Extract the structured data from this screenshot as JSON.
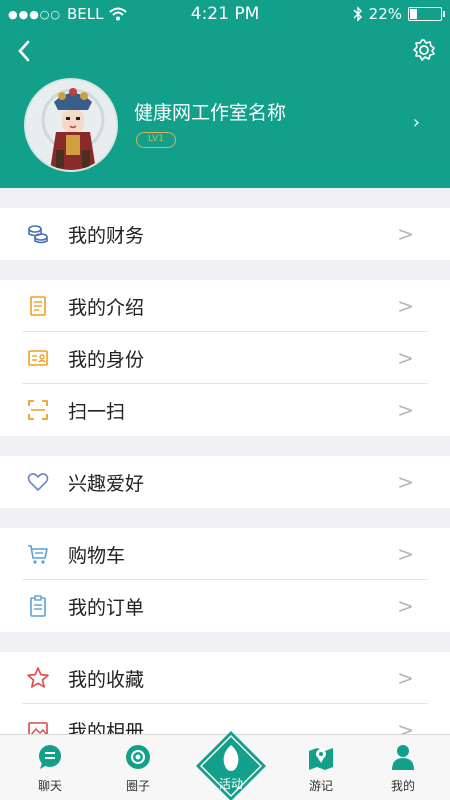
{
  "status_bar": {
    "carrier": "BELL",
    "time": "4:21 PM",
    "battery": "22%",
    "battery_level": 0.22
  },
  "profile": {
    "name": "健康网工作室名称",
    "level": "LV1"
  },
  "menu_groups": [
    [
      {
        "label": "我的财务",
        "icon": "coins-icon"
      }
    ],
    [
      {
        "label": "我的介绍",
        "icon": "document-icon"
      },
      {
        "label": "我的身份",
        "icon": "id-card-icon"
      },
      {
        "label": "扫一扫",
        "icon": "scan-icon"
      }
    ],
    [
      {
        "label": "兴趣爱好",
        "icon": "heart-icon"
      }
    ],
    [
      {
        "label": "购物车",
        "icon": "cart-icon"
      },
      {
        "label": "我的订单",
        "icon": "clipboard-icon"
      }
    ],
    [
      {
        "label": "我的收藏",
        "icon": "star-icon"
      },
      {
        "label": "我的相册",
        "icon": "photo-icon"
      }
    ]
  ],
  "chevron": ">",
  "tabs": [
    {
      "label": "聊天",
      "icon": "chat-icon"
    },
    {
      "label": "圈子",
      "icon": "circle-icon"
    },
    {
      "label": "活动",
      "icon": "activity-icon"
    },
    {
      "label": "游记",
      "icon": "map-icon"
    },
    {
      "label": "我的",
      "icon": "person-icon"
    }
  ],
  "colors": {
    "brand": "#13a08a",
    "gold": "#d6b25a",
    "blue": "#4a6fb5",
    "orange": "#f0a020",
    "red": "#e04848"
  }
}
